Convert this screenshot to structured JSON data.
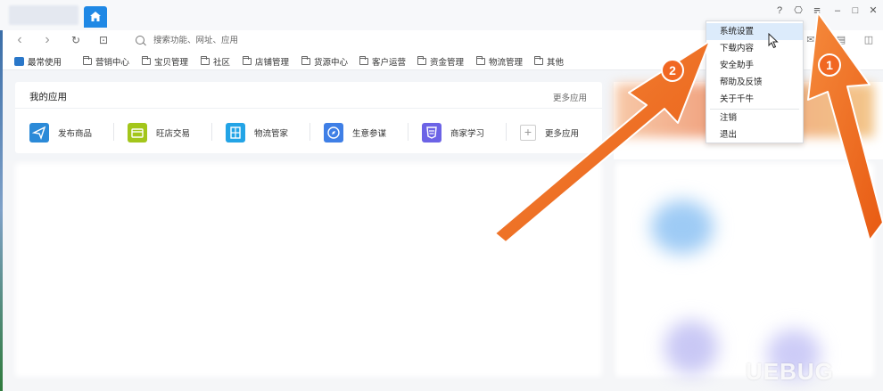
{
  "titlebar": {
    "controls": {
      "help_icon": "?",
      "skin_icon": "⎔",
      "menu_icon": "≡",
      "minimize": "–",
      "maximize": "□",
      "close": "✕"
    }
  },
  "navbar": {
    "back": "‹",
    "forward": "›",
    "refresh": "↻",
    "screenshot": "⊡",
    "search_placeholder": "搜索功能、网址、应用"
  },
  "bookmarks": [
    {
      "label": "最常使用",
      "icon": "cube-icon"
    },
    {
      "label": "营销中心",
      "icon": "folder-icon"
    },
    {
      "label": "宝贝管理",
      "icon": "folder-icon"
    },
    {
      "label": "社区",
      "icon": "folder-icon"
    },
    {
      "label": "店铺管理",
      "icon": "folder-icon"
    },
    {
      "label": "货源中心",
      "icon": "folder-icon"
    },
    {
      "label": "客户运营",
      "icon": "folder-icon"
    },
    {
      "label": "资金管理",
      "icon": "folder-icon"
    },
    {
      "label": "物流管理",
      "icon": "folder-icon"
    },
    {
      "label": "其他",
      "icon": "folder-icon"
    }
  ],
  "my_apps": {
    "title": "我的应用",
    "more_link": "更多应用",
    "apps": [
      {
        "label": "发布商品",
        "color": "#2b8ad8"
      },
      {
        "label": "旺店交易",
        "color": "#a3c61b"
      },
      {
        "label": "物流管家",
        "color": "#23a4e6"
      },
      {
        "label": "生意参谋",
        "color": "#3f7fe6"
      },
      {
        "label": "商家学习",
        "color": "#6c63e6"
      },
      {
        "label": "更多应用",
        "color": "#cccccc"
      }
    ]
  },
  "menu": {
    "items": [
      {
        "label": "系统设置",
        "highlighted": true
      },
      {
        "label": "下载内容"
      },
      {
        "label": "安全助手"
      },
      {
        "label": "帮助及反馈"
      },
      {
        "label": "关于千牛"
      },
      {
        "label": "注销"
      },
      {
        "label": "退出"
      }
    ]
  },
  "annotations": {
    "badge_1": "1",
    "badge_2": "2",
    "arrow_color": "#f16722"
  },
  "watermark": "UEBUG"
}
